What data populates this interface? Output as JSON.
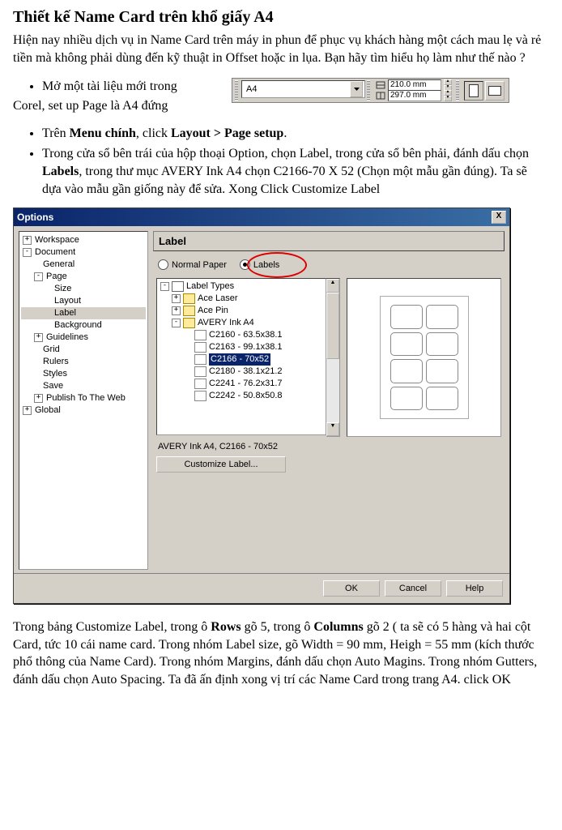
{
  "title": "Thiết kế Name Card trên khổ giấy A4",
  "intro": "Hiện nay nhiều dịch vụ in Name Card trên máy in phun để phục vụ khách hàng một cách mau lẹ và rẻ tiền mà không phải dùng đến kỹ thuật in Offset hoặc in lụa. Bạn hãy tìm hiểu họ làm như thế nào ?",
  "bullet1": "Mở một tài liệu mới trong",
  "bullet1b": "Corel, set up Page là A4 đứng",
  "toolbar": {
    "paper": "A4",
    "width": "210.0 mm",
    "height": "297.0 mm"
  },
  "bullet2": {
    "prefix": "Trên ",
    "menu": "Menu chính",
    "mid": ", click ",
    "path": "Layout > Page setup",
    "suffix": "."
  },
  "bullet3": {
    "t1": "Trong cửa sổ bên trái của hộp thoại Option, chọn Label, trong cửa sổ bên phải, đánh dấu chọn ",
    "labels": "Labels",
    "t2": ", trong thư mục AVERY Ink A4 chọn C2166-70 X 52 (Chọn một mẫu gần đúng). Ta sẽ dựa vào mẫu gần giống này để sửa. Xong Click Customize Label"
  },
  "dialog": {
    "title": "Options",
    "close": "X",
    "left_tree": [
      {
        "lvl": 0,
        "exp": "+",
        "label": "Workspace"
      },
      {
        "lvl": 0,
        "exp": "-",
        "label": "Document"
      },
      {
        "lvl": 1,
        "exp": "",
        "label": "General"
      },
      {
        "lvl": 1,
        "exp": "-",
        "label": "Page"
      },
      {
        "lvl": 2,
        "exp": "",
        "label": "Size"
      },
      {
        "lvl": 2,
        "exp": "",
        "label": "Layout"
      },
      {
        "lvl": 2,
        "exp": "",
        "label": "Label",
        "sel": true
      },
      {
        "lvl": 2,
        "exp": "",
        "label": "Background"
      },
      {
        "lvl": 1,
        "exp": "+",
        "label": "Guidelines"
      },
      {
        "lvl": 1,
        "exp": "",
        "label": "Grid"
      },
      {
        "lvl": 1,
        "exp": "",
        "label": "Rulers"
      },
      {
        "lvl": 1,
        "exp": "",
        "label": "Styles"
      },
      {
        "lvl": 1,
        "exp": "",
        "label": "Save"
      },
      {
        "lvl": 1,
        "exp": "+",
        "label": "Publish To The Web"
      },
      {
        "lvl": 0,
        "exp": "+",
        "label": "Global"
      }
    ],
    "panel_title": "Label",
    "radio_normal": "Normal Paper",
    "radio_labels": "Labels",
    "label_types_root": "Label Types",
    "lt": [
      {
        "lvl": 1,
        "exp": "+",
        "icon": "folder",
        "label": "Ace Laser"
      },
      {
        "lvl": 1,
        "exp": "+",
        "icon": "folder",
        "label": "Ace Pin"
      },
      {
        "lvl": 1,
        "exp": "-",
        "icon": "folder",
        "label": "AVERY Ink A4"
      },
      {
        "lvl": 2,
        "exp": "",
        "icon": "file",
        "label": "C2160 - 63.5x38.1"
      },
      {
        "lvl": 2,
        "exp": "",
        "icon": "file",
        "label": "C2163 - 99.1x38.1"
      },
      {
        "lvl": 2,
        "exp": "",
        "icon": "file",
        "label": "C2166 - 70x52",
        "sel": true
      },
      {
        "lvl": 2,
        "exp": "",
        "icon": "file",
        "label": "C2180 - 38.1x21.2"
      },
      {
        "lvl": 2,
        "exp": "",
        "icon": "file",
        "label": "C2241 - 76.2x31.7"
      },
      {
        "lvl": 2,
        "exp": "",
        "icon": "file",
        "label": "C2242 - 50.8x50.8"
      }
    ],
    "status": "AVERY Ink A4, C2166 - 70x52",
    "customize": "Customize Label...",
    "ok": "OK",
    "cancel": "Cancel",
    "help": "Help"
  },
  "final": {
    "t1": "Trong bảng Customize Label, trong ô ",
    "rows": "Rows",
    "t2": " gõ 5, trong ô ",
    "cols": "Columns",
    "t3": " gõ 2 ( ta sẽ có 5 hàng và hai cột Card, tức 10 cái name card. Trong nhóm Label size, gõ Width = 90 mm, Heigh = 55 mm (kích thước phổ thông của Name Card). Trong nhóm Margins, đánh dấu chọn Auto Magins. Trong nhóm Gutters, đánh dấu chọn Auto Spacing. Ta đã ấn định xong vị trí các Name Card trong trang A4. click OK"
  }
}
